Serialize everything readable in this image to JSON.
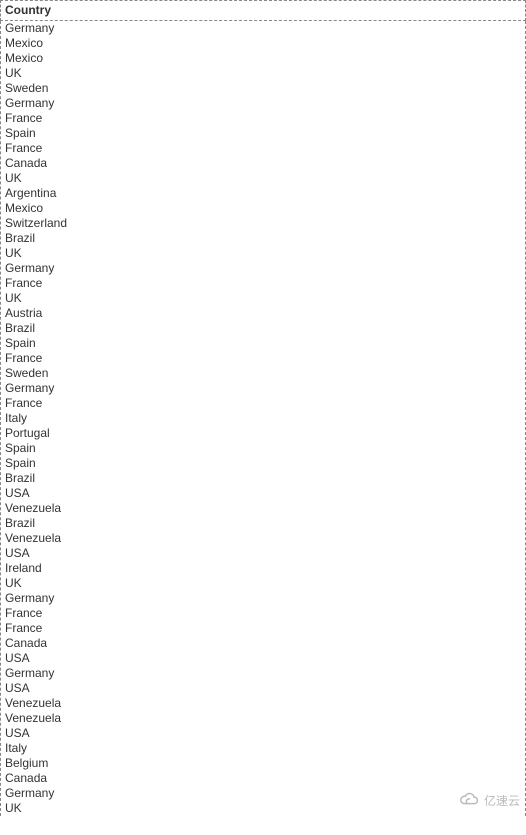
{
  "table": {
    "header": "Country",
    "rows": [
      "Germany",
      "Mexico",
      "Mexico",
      "UK",
      "Sweden",
      "Germany",
      "France",
      "Spain",
      "France",
      "Canada",
      "UK",
      "Argentina",
      "Mexico",
      "Switzerland",
      "Brazil",
      "UK",
      "Germany",
      "France",
      "UK",
      "Austria",
      "Brazil",
      "Spain",
      "France",
      "Sweden",
      "Germany",
      "France",
      "Italy",
      "Portugal",
      "Spain",
      "Spain",
      "Brazil",
      "USA",
      "Venezuela",
      "Brazil",
      "Venezuela",
      "USA",
      "Ireland",
      "UK",
      "Germany",
      "France",
      "France",
      "Canada",
      "USA",
      "Germany",
      "USA",
      "Venezuela",
      "Venezuela",
      "USA",
      "Italy",
      "Belgium",
      "Canada",
      "Germany",
      "UK"
    ]
  },
  "watermark": {
    "text": "亿速云"
  }
}
